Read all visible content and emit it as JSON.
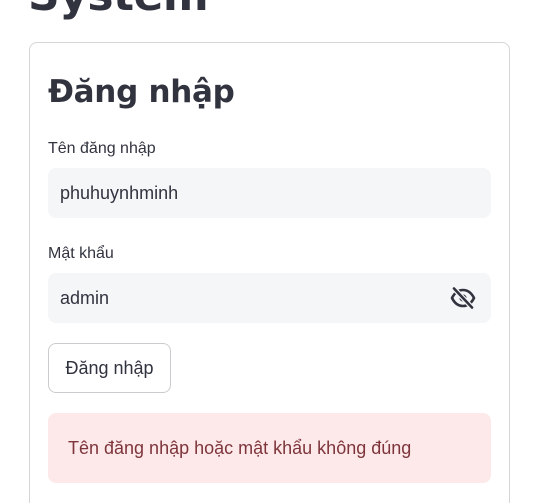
{
  "page": {
    "title": "System"
  },
  "login": {
    "heading": "Đăng nhập",
    "username_label": "Tên đăng nhập",
    "username_value": "phuhuynhminh",
    "password_label": "Mật khẩu",
    "password_value": "admin",
    "password_visibility_icon": "eye-off-icon",
    "submit_label": "Đăng nhập",
    "error_message": "Tên đăng nhập hoặc mật khẩu không đúng"
  },
  "colors": {
    "text": "#31333f",
    "input_background": "#f5f6f8",
    "error_background": "#fde9ea",
    "error_text": "#7d353b"
  }
}
